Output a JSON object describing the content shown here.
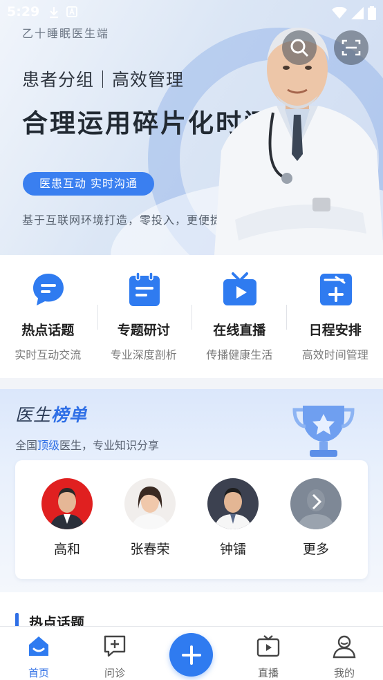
{
  "status_bar": {
    "time": "5:29"
  },
  "banner": {
    "brand": "乙十睡眠医生端",
    "headline1": "患者分组｜高效管理",
    "headline2": "合理运用碎片化时间",
    "tag": "医患互动 实时沟通",
    "subline": "基于互联网环境打造，零投入，更便捷"
  },
  "features": [
    {
      "title": "热点话题",
      "subtitle": "实时互动交流",
      "icon": "chat-bubble-icon"
    },
    {
      "title": "专题研讨",
      "subtitle": "专业深度剖析",
      "icon": "notepad-icon"
    },
    {
      "title": "在线直播",
      "subtitle": "传播健康生活",
      "icon": "tv-play-icon"
    },
    {
      "title": "日程安排",
      "subtitle": "高效时间管理",
      "icon": "calendar-plus-icon"
    }
  ],
  "ranking": {
    "title_plain": "医生",
    "title_highlight": "榜单",
    "subtitle_prefix": "全国",
    "subtitle_highlight": "顶级",
    "subtitle_suffix": "医生，专业知识分享",
    "doctors": [
      {
        "name": "高和"
      },
      {
        "name": "张春荣"
      },
      {
        "name": "钟镭"
      },
      {
        "name": "更多"
      }
    ]
  },
  "hot_topics": {
    "title": "热点话题"
  },
  "tabbar": {
    "tabs": [
      {
        "label": "首页",
        "icon": "home-icon",
        "active": true
      },
      {
        "label": "问诊",
        "icon": "consult-icon",
        "active": false
      },
      {
        "label": "直播",
        "icon": "live-tv-icon",
        "active": false
      },
      {
        "label": "我的",
        "icon": "profile-icon",
        "active": false
      }
    ]
  },
  "colors": {
    "accent": "#2f6fe6",
    "plus_button": "#2f7bf0"
  }
}
